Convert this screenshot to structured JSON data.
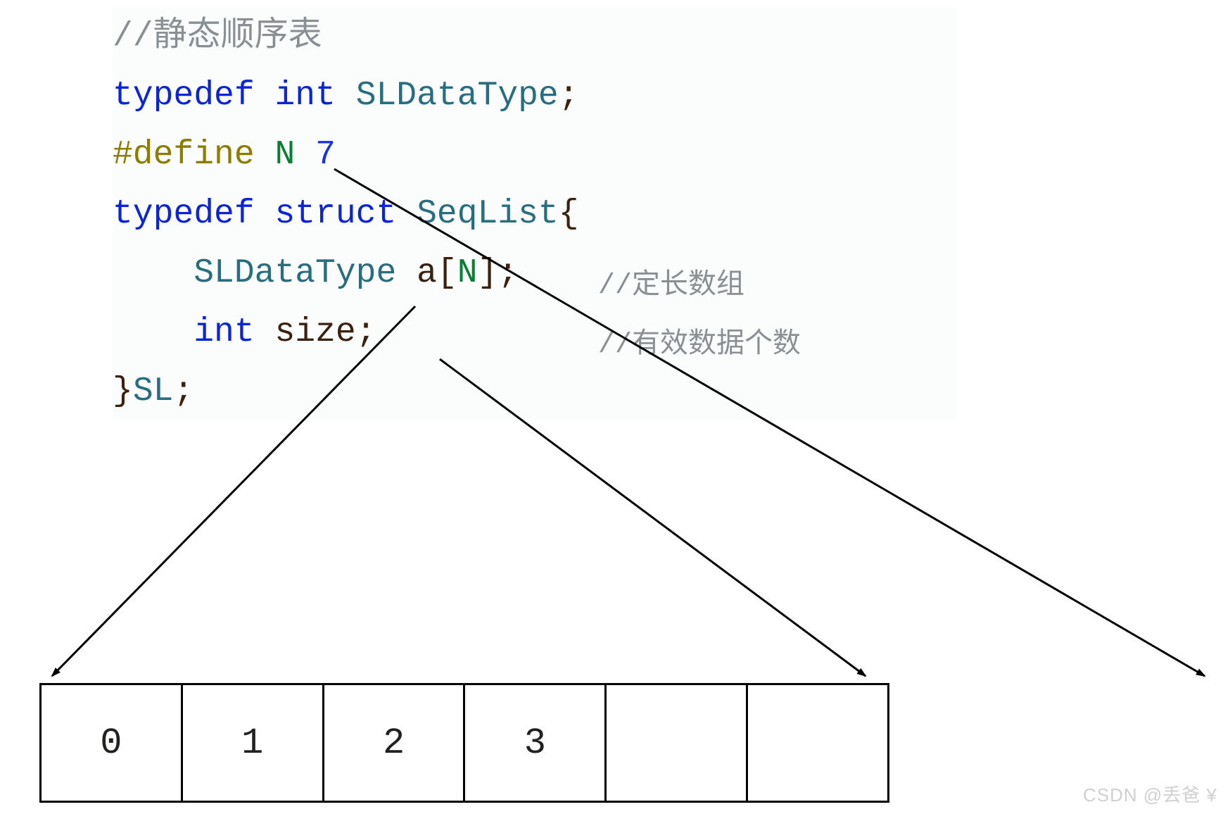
{
  "code": {
    "comment_top": "//静态顺序表",
    "typedef_kw": "typedef",
    "int_kw": "int",
    "sldatatype": "SLDataType",
    "semi": ";",
    "define_kw": "#define",
    "define_name": "N",
    "define_value": "7",
    "struct_kw": "struct",
    "seqlist": "SeqList",
    "lbrace": "{",
    "array_decl_type": "SLDataType",
    "array_decl_name": "a",
    "array_decl_open": "[",
    "array_decl_N": "N",
    "array_decl_close": "]",
    "size_kw": "int",
    "size_name": "size",
    "rbrace": "}",
    "sl": "SL",
    "side_comment_1": "//定长数组",
    "side_comment_2": "//有效数据个数"
  },
  "array_cells": [
    "0",
    "1",
    "2",
    "3",
    "",
    ""
  ],
  "watermark": "CSDN @丢爸 ¥"
}
